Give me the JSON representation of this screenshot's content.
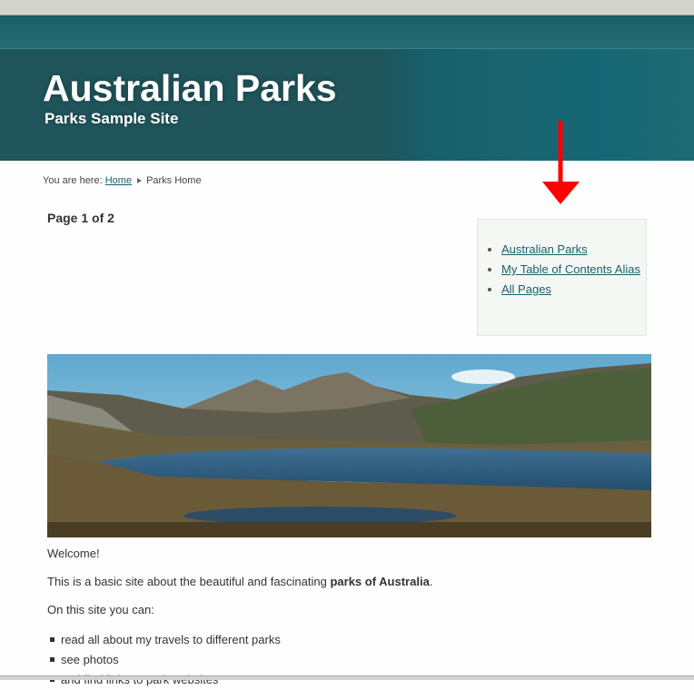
{
  "header": {
    "title": "Australian Parks",
    "subtitle": "Parks Sample Site"
  },
  "breadcrumb": {
    "prefix": "You are here:",
    "home": "Home",
    "current": "Parks Home"
  },
  "page_indicator": "Page 1 of 2",
  "toc": {
    "items": [
      {
        "label": "Australian Parks"
      },
      {
        "label": "My Table of Contents Alias"
      },
      {
        "label": "All Pages"
      }
    ]
  },
  "content": {
    "welcome": "Welcome!",
    "intro_before": "This is a basic site about the beautiful and fascinating ",
    "intro_bold": "parks of Australia",
    "intro_after": ".",
    "lead": "On this site you can:",
    "bullets": [
      "read all about my travels to different parks",
      "see photos",
      "and find links to park websites"
    ]
  },
  "annotation": {
    "arrow_color": "#ff0000",
    "icon": "arrow-down-icon"
  },
  "colors": {
    "header": "#20555c",
    "link": "#1b5f6c"
  }
}
